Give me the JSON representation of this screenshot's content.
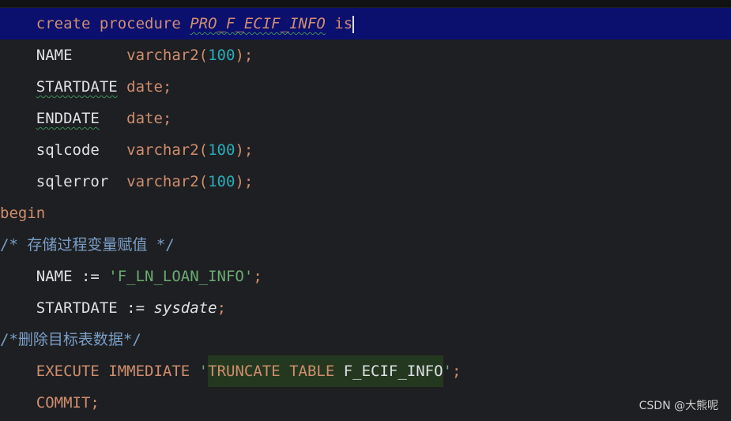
{
  "lines": {
    "l1": {
      "kw1": "create procedure ",
      "name": "PRO_F_ECIF_INFO",
      "kw2": " is"
    },
    "l2": {
      "name": "NAME      ",
      "type": "varchar2(",
      "num": "100",
      "end": ");"
    },
    "l3": {
      "name": "STARTDATE",
      "type": " date;"
    },
    "l4": {
      "name": "ENDDATE",
      "type": "   date;"
    },
    "l5": {
      "name": "sqlcode   ",
      "type": "varchar2(",
      "num": "100",
      "end": ");"
    },
    "l6": {
      "name": "sqlerror  ",
      "type": "varchar2(",
      "num": "100",
      "end": ");"
    },
    "l7": {
      "kw": "begin"
    },
    "l8": {
      "open": "/* ",
      "text": "存储过程变量赋值",
      "close": " */"
    },
    "l9": {
      "name": "NAME := ",
      "str": "'F_LN_LOAN_INFO'",
      "end": ";"
    },
    "l10": {
      "name": "STARTDATE := ",
      "ital": "sysdate",
      "end": ";"
    },
    "l11": {
      "open": "/*",
      "text": "删除目标表数据",
      "close": "*/"
    },
    "l12": {
      "kw": "EXECUTE IMMEDIATE ",
      "q1": "'",
      "sqlkw": "TRUNCATE TABLE ",
      "tbl": "F_ECIF_INFO",
      "q2": "'",
      "end": ";"
    },
    "l13": {
      "kw": "COMMIT;"
    }
  },
  "watermark": "CSDN @大熊呢"
}
